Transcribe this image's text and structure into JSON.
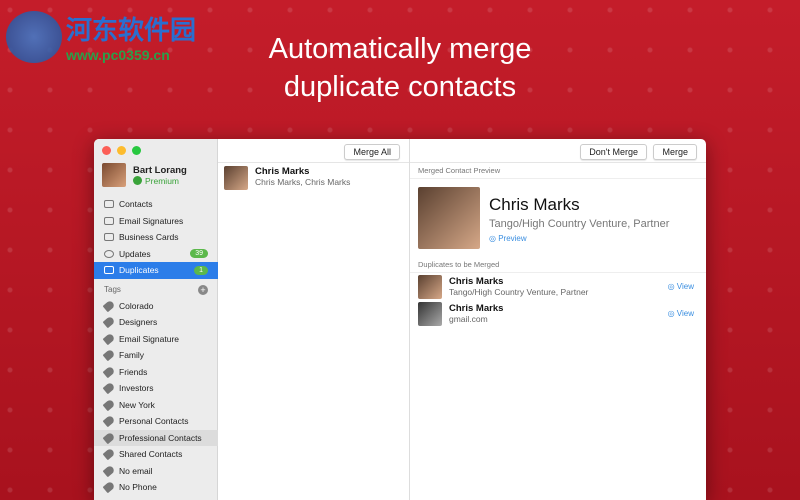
{
  "watermark": {
    "title": "河东软件园",
    "url": "www.pc0359.cn"
  },
  "headline": {
    "line1": "Automatically merge",
    "line2": "duplicate contacts"
  },
  "user": {
    "name": "Bart Lorang",
    "plan": "Premium"
  },
  "nav": [
    {
      "label": "Contacts"
    },
    {
      "label": "Email Signatures"
    },
    {
      "label": "Business Cards"
    },
    {
      "label": "Updates",
      "badge": "39"
    },
    {
      "label": "Duplicates",
      "badge": "1"
    }
  ],
  "tags_header": "Tags",
  "tags": [
    "Colorado",
    "Designers",
    "Email Signature",
    "Family",
    "Friends",
    "Investors",
    "New York",
    "Personal Contacts",
    "Professional Contacts",
    "Shared Contacts",
    "No email",
    "No Phone"
  ],
  "list": {
    "merge_all": "Merge All",
    "item": {
      "name": "Chris Marks",
      "sub": "Chris Marks, Chris Marks"
    }
  },
  "detail": {
    "dont_merge": "Don't Merge",
    "merge": "Merge",
    "preview_header": "Merged Contact Preview",
    "name": "Chris Marks",
    "sub": "Tango/High Country Venture, Partner",
    "preview": "Preview",
    "dup_header": "Duplicates to be Merged",
    "dups": [
      {
        "name": "Chris Marks",
        "sub": "Tango/High Country Venture, Partner",
        "view": "View"
      },
      {
        "name": "Chris Marks",
        "sub": "gmail.com",
        "view": "View"
      }
    ]
  }
}
